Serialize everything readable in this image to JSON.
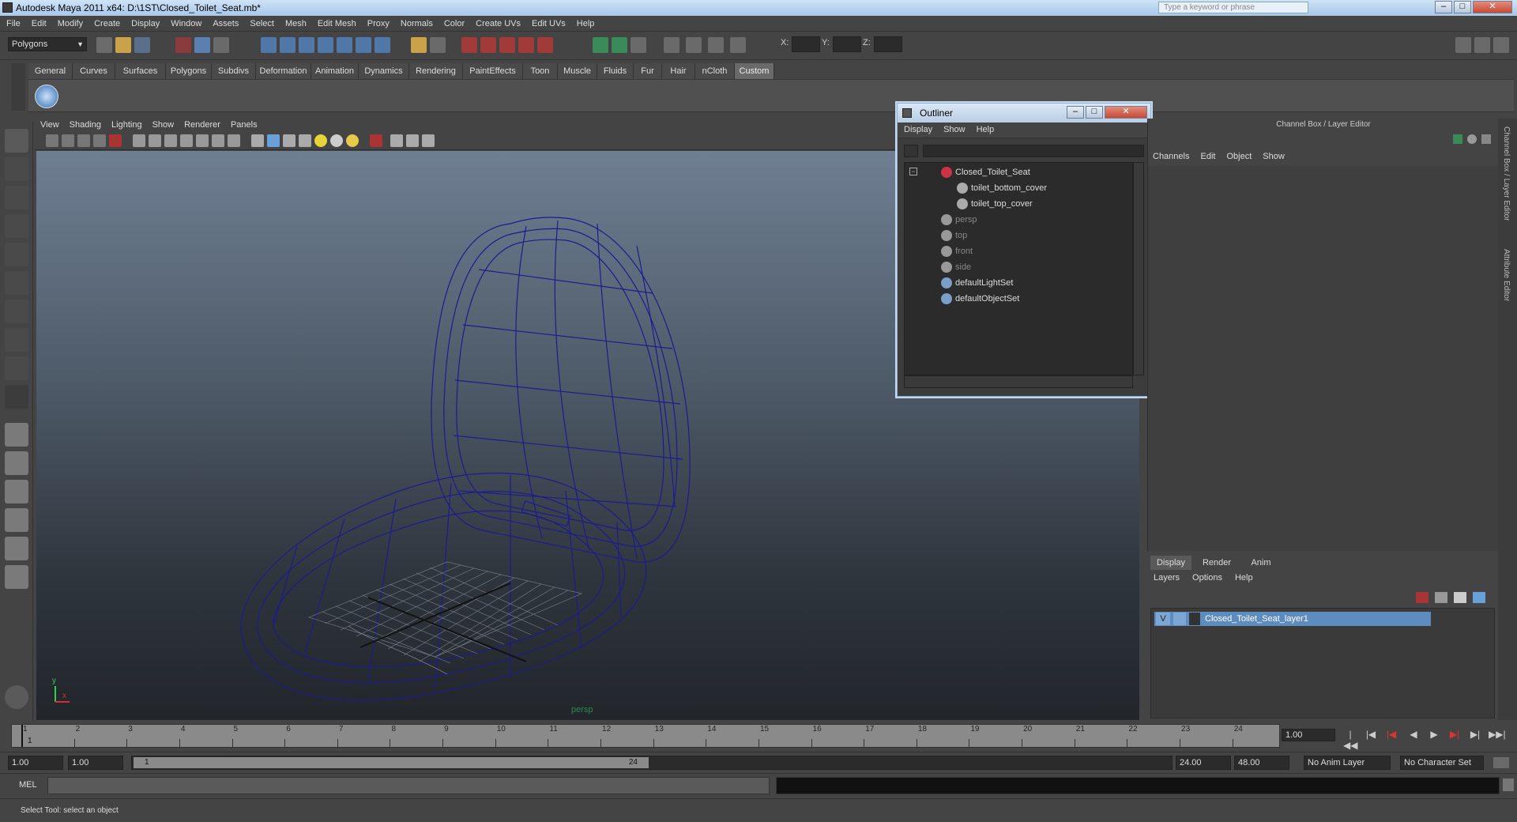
{
  "window": {
    "title": "Autodesk Maya 2011 x64: D:\\1ST\\Closed_Toilet_Seat.mb*",
    "search_placeholder": "Type a keyword or phrase"
  },
  "menubar": [
    "File",
    "Edit",
    "Modify",
    "Create",
    "Display",
    "Window",
    "Assets",
    "Select",
    "Mesh",
    "Edit Mesh",
    "Proxy",
    "Normals",
    "Color",
    "Create UVs",
    "Edit UVs",
    "Help"
  ],
  "status": {
    "mode": "Polygons",
    "x_label": "X:",
    "y_label": "Y:",
    "z_label": "Z:"
  },
  "shelf_tabs": [
    "General",
    "Curves",
    "Surfaces",
    "Polygons",
    "Subdivs",
    "Deformation",
    "Animation",
    "Dynamics",
    "Rendering",
    "PaintEffects",
    "Toon",
    "Muscle",
    "Fluids",
    "Fur",
    "Hair",
    "nCloth",
    "Custom"
  ],
  "shelf_active": "Custom",
  "viewport": {
    "menu": [
      "View",
      "Shading",
      "Lighting",
      "Show",
      "Renderer",
      "Panels"
    ],
    "camera": "persp",
    "axis_y": "y",
    "axis_x": "x"
  },
  "outliner": {
    "title": "Outliner",
    "menu": [
      "Display",
      "Show",
      "Help"
    ],
    "items": [
      {
        "label": "Closed_Toilet_Seat",
        "dim": false
      },
      {
        "label": "toilet_bottom_cover",
        "dim": false
      },
      {
        "label": "toilet_top_cover",
        "dim": false
      },
      {
        "label": "persp",
        "dim": true
      },
      {
        "label": "top",
        "dim": true
      },
      {
        "label": "front",
        "dim": true
      },
      {
        "label": "side",
        "dim": true
      },
      {
        "label": "defaultLightSet",
        "dim": false
      },
      {
        "label": "defaultObjectSet",
        "dim": false
      }
    ]
  },
  "channel_box": {
    "title": "Channel Box / Layer Editor",
    "menu": [
      "Channels",
      "Edit",
      "Object",
      "Show"
    ]
  },
  "layer_editor": {
    "tabs": [
      "Display",
      "Render",
      "Anim"
    ],
    "menu": [
      "Layers",
      "Options",
      "Help"
    ],
    "layer_v": "V",
    "layer_name": "Closed_Toilet_Seat_layer1"
  },
  "side_tabs": [
    "Channel Box / Layer Editor",
    "Attribute Editor"
  ],
  "timeline": {
    "ticks": [
      "1",
      "2",
      "3",
      "4",
      "5",
      "6",
      "7",
      "8",
      "9",
      "10",
      "11",
      "12",
      "13",
      "14",
      "15",
      "16",
      "17",
      "18",
      "19",
      "20",
      "21",
      "22",
      "23",
      "24"
    ],
    "current": "1",
    "current_field": "1.00"
  },
  "range": {
    "start": "1.00",
    "start2": "1.00",
    "handle_start": "1",
    "handle_end": "24",
    "end": "24.00",
    "end2": "48.00",
    "anim_layer": "No Anim Layer",
    "char_set": "No Character Set"
  },
  "command": {
    "label": "MEL"
  },
  "help": {
    "text": "Select Tool: select an object"
  }
}
